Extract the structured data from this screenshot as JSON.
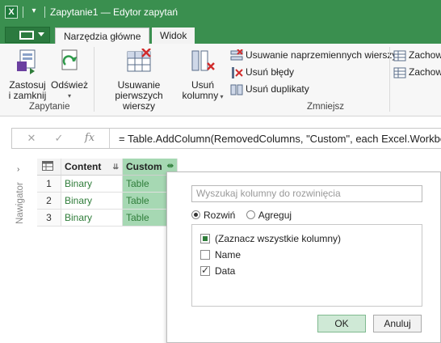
{
  "window": {
    "title": "Zapytanie1 — Edytor zapytań",
    "app_icon": "X"
  },
  "tabs": {
    "home": "Narzędzia główne",
    "view": "Widok"
  },
  "ribbon": {
    "apply_close": [
      "Zastosuj",
      "i zamknij"
    ],
    "refresh": "Odśwież",
    "group_query": "Zapytanie",
    "remove_top_rows": [
      "Usuwanie",
      "pierwszych wierszy"
    ],
    "remove_columns": [
      "Usuń",
      "kolumny"
    ],
    "remove_alternate_rows": "Usuwanie naprzemiennych wierszy",
    "remove_errors": "Usuń błędy",
    "remove_duplicates": "Usuń duplikaty",
    "keep_1": "Zachow",
    "keep_2": "Zachow",
    "group_reduce": "Zmniejsz"
  },
  "formula_bar": {
    "cancel": "✕",
    "confirm": "✓",
    "fx": "fx",
    "formula": "= Table.AddColumn(RemovedColumns, \"Custom\", each Excel.Workbo"
  },
  "navigator": {
    "label": "Nawigator"
  },
  "table": {
    "headers": [
      "Content",
      "Custom"
    ],
    "rows": [
      {
        "num": "1",
        "content": "Binary",
        "custom": "Table"
      },
      {
        "num": "2",
        "content": "Binary",
        "custom": "Table"
      },
      {
        "num": "3",
        "content": "Binary",
        "custom": "Table"
      }
    ]
  },
  "expand_popup": {
    "search_placeholder": "Wyszukaj kolumny do rozwinięcia",
    "expand": "Rozwiń",
    "aggregate": "Agreguj",
    "select_all": "(Zaznacz wszystkie kolumny)",
    "columns": [
      {
        "name": "Name",
        "checked": false
      },
      {
        "name": "Data",
        "checked": true
      }
    ],
    "ok": "OK",
    "cancel": "Anuluj"
  }
}
